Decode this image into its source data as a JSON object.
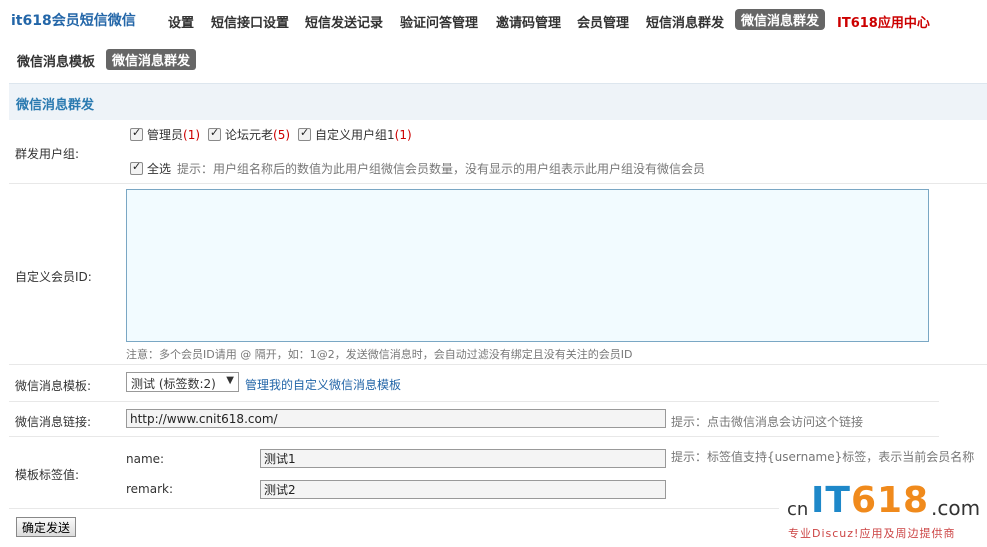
{
  "nav": {
    "brand": "it618会员短信微信",
    "items": [
      "设置",
      "短信接口设置",
      "短信发送记录",
      "验证问答管理",
      "邀请码管理",
      "会员管理",
      "短信消息群发",
      "微信消息群发",
      "IT618应用中心"
    ],
    "active": "微信消息群发"
  },
  "subnav": {
    "items": [
      "微信消息模板",
      "微信消息群发"
    ],
    "active": "微信消息群发"
  },
  "section": {
    "title": "微信消息群发"
  },
  "group": {
    "label": "群发用户组:",
    "options": [
      {
        "name": "管理员",
        "count": "(1)",
        "checked": true
      },
      {
        "name": "论坛元老",
        "count": "(5)",
        "checked": true
      },
      {
        "name": "自定义用户组1",
        "count": "(1)",
        "checked": true
      }
    ],
    "select_all": "全选",
    "tip": "提示：用户组名称后的数值为此用户组微信会员数量，没有显示的用户组表示此用户组没有微信会员"
  },
  "custom_ids": {
    "label": "自定义会员ID:",
    "value": "",
    "note": "注意：多个会员ID请用 @ 隔开，如：1@2，发送微信消息时，会自动过滤没有绑定且没有关注的会员ID"
  },
  "template": {
    "label": "微信消息模板:",
    "selected": "测试 (标签数:2)",
    "manage_link": "管理我的自定义微信消息模板"
  },
  "link": {
    "label": "微信消息链接:",
    "value": "http://www.cnit618.com/",
    "tip": "提示：点击微信消息会访问这个链接"
  },
  "tags": {
    "label": "模板标签值:",
    "tip": "提示：标签值支持{username}标签，表示当前会员名称",
    "fields": [
      {
        "name": "name:",
        "value": "测试1"
      },
      {
        "name": "remark:",
        "value": "测试2"
      }
    ]
  },
  "submit_label": "确定发送",
  "watermark": {
    "cn": "cn",
    "it": "IT",
    "num": "618",
    "com": ".com",
    "slogan": "专业Discuz!应用及周边提供商"
  }
}
